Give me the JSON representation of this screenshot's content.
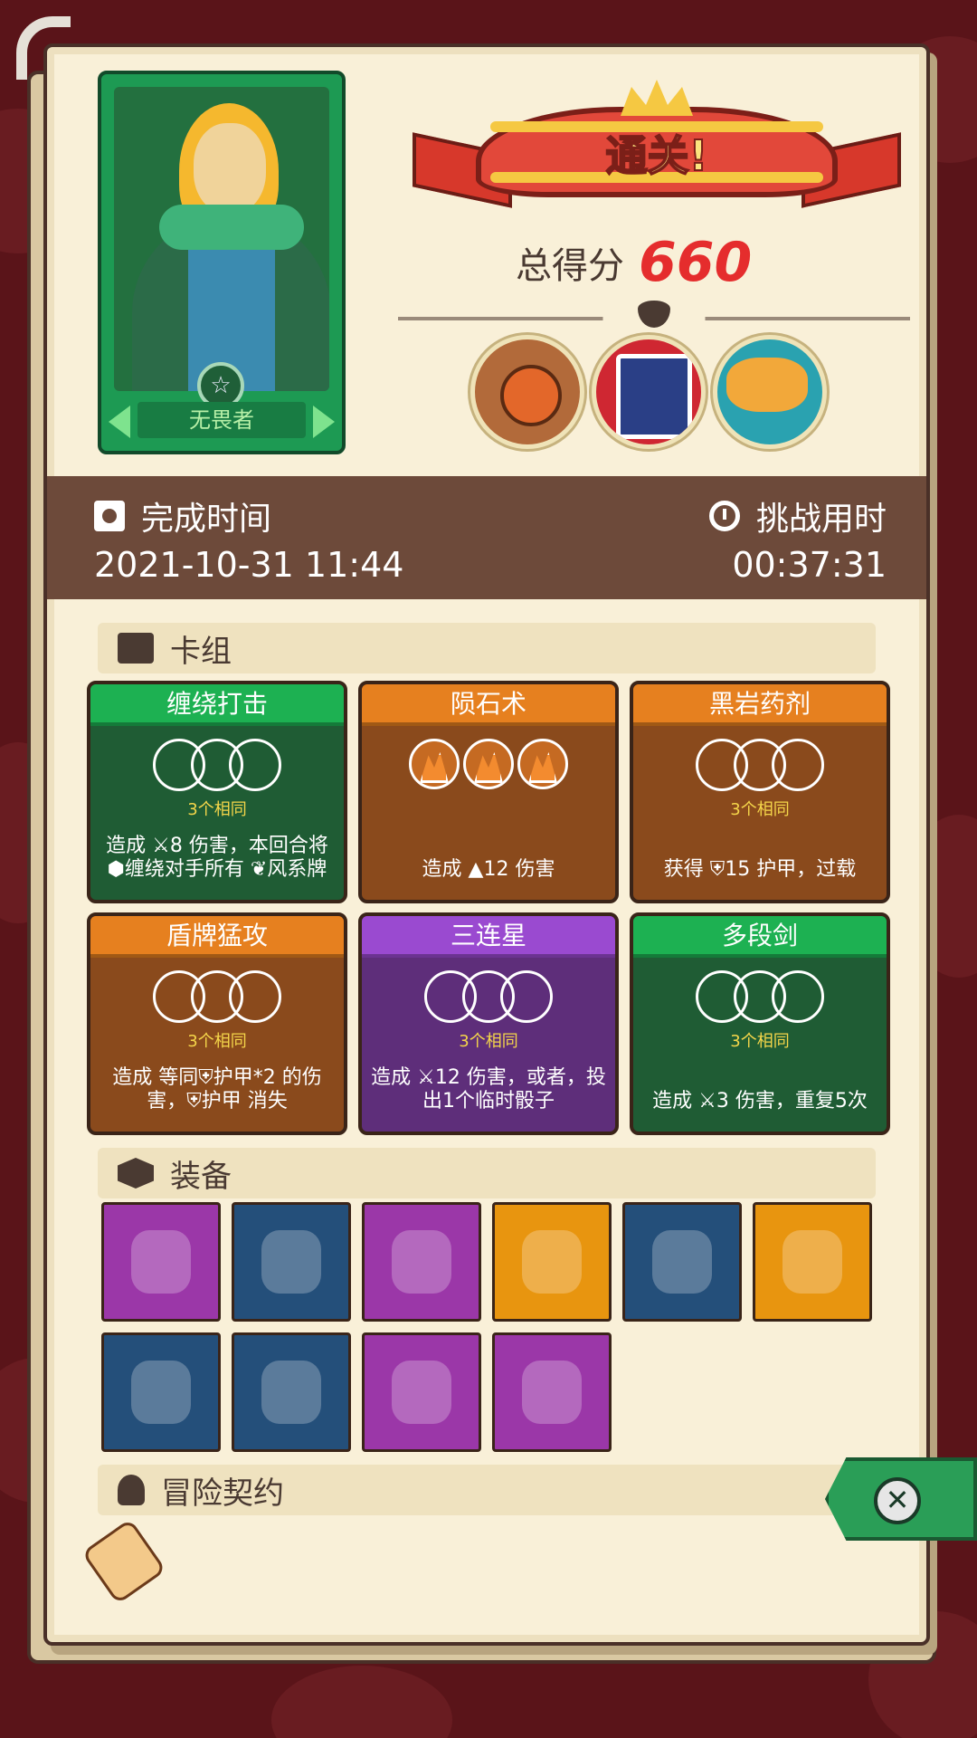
{
  "character": {
    "name": "无畏者",
    "medal_icon": "star-medal-icon"
  },
  "result": {
    "title": "通关!",
    "score_label": "总得分",
    "score_value": "660"
  },
  "bosses": [
    "cyclops-boss",
    "cage-boss",
    "fish-boss"
  ],
  "time_bar": {
    "completion_label": "完成时间",
    "completion_value": "2021-10-31 11:44",
    "challenge_label": "挑战用时",
    "challenge_value": "00:37:31"
  },
  "deck": {
    "heading": "卡组",
    "cards": [
      {
        "name": "缠绕打击",
        "color": "green",
        "same": "3个相同",
        "desc": "造成 ⚔8 伤害，本回合将⬢缠绕对手所有 ❦风系牌"
      },
      {
        "name": "陨石术",
        "color": "orange",
        "same": "",
        "desc": "造成 ▲12 伤害"
      },
      {
        "name": "黑岩药剂",
        "color": "orange",
        "same": "3个相同",
        "desc": "获得 ⛨15 护甲，过载"
      },
      {
        "name": "盾牌猛攻",
        "color": "orange",
        "same": "3个相同",
        "desc": "造成 等同⛨护甲*2 的伤害，⛨护甲 消失"
      },
      {
        "name": "三连星",
        "color": "purple",
        "same": "3个相同",
        "desc": "造成 ⚔12 伤害，或者，投出1个临时骰子"
      },
      {
        "name": "多段剑",
        "color": "green",
        "same": "3个相同",
        "desc": "造成 ⚔3 伤害，重复5次"
      }
    ]
  },
  "equipment": {
    "heading": "装备",
    "items": [
      {
        "icon": "mirror-icon",
        "color": "purple"
      },
      {
        "icon": "leaf-ring-icon",
        "color": "blue"
      },
      {
        "icon": "claw-icon",
        "color": "purple"
      },
      {
        "icon": "jar-icon",
        "color": "orange"
      },
      {
        "icon": "skull-icon",
        "color": "blue"
      },
      {
        "icon": "vase-icon",
        "color": "orange"
      },
      {
        "icon": "tentacle-hood-icon",
        "color": "blue"
      },
      {
        "icon": "compass-emblem-icon",
        "color": "blue"
      },
      {
        "icon": "dragon-crest-icon",
        "color": "purple"
      },
      {
        "icon": "glove-icon",
        "color": "purple"
      }
    ]
  },
  "contract": {
    "heading": "冒险契约",
    "item_icon": "scroll-icon"
  },
  "colors": {
    "board": "#f9f0d8",
    "timebar": "#6d4a3a",
    "score": "#e52d2d"
  }
}
